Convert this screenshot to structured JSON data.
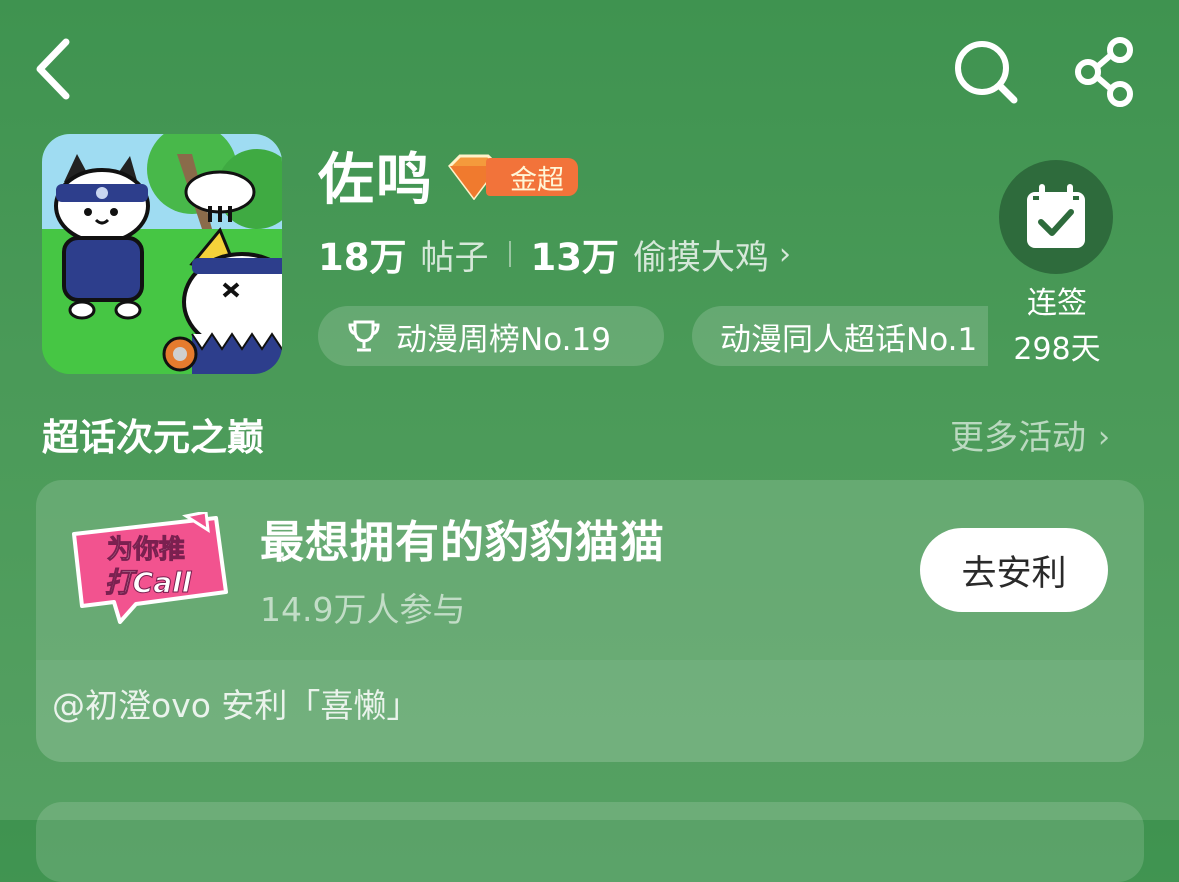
{
  "topbar": {
    "back_icon": "chevron-left-icon",
    "search_icon": "search-icon",
    "share_icon": "share-icon"
  },
  "topic": {
    "name": "佐鸣",
    "badge_level": "2",
    "badge_label": "金超",
    "posts_count": "18万",
    "posts_label": "帖子",
    "members_count": "13万",
    "members_label": "偷摸大鸡",
    "chevron": "›"
  },
  "ranks": [
    {
      "label": "动漫周榜No.19",
      "icon": "trophy-icon"
    },
    {
      "label": "动漫同人超话No.1"
    }
  ],
  "checkin": {
    "icon": "calendar-check-icon",
    "label": "连签",
    "days": "298天"
  },
  "section": {
    "title": "超话次元之巅",
    "more_label": "更多活动",
    "chevron": "›"
  },
  "activity": {
    "badge_line1": "为你推",
    "badge_line2": "打Call",
    "title": "最想拥有的豹豹猫猫",
    "participants": "14.9万人参与",
    "button_label": "去安利",
    "footer": "@初澄ovo 安利「喜懒」"
  },
  "colors": {
    "background": "#3f9350",
    "badge_orange": "#f2733a",
    "checkin_circle": "#2e6b3c",
    "promo_pink": "#f2538f"
  }
}
